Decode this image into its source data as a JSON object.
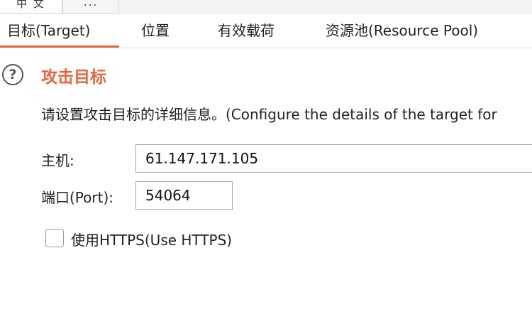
{
  "top_tabs": [
    {
      "label": "中 文"
    },
    {
      "label": "..."
    }
  ],
  "sub_tabs": [
    {
      "label": "目标(Target)",
      "active": true
    },
    {
      "label": "位置"
    },
    {
      "label": "有效载荷"
    },
    {
      "label": "资源池(Resource Pool)"
    }
  ],
  "section": {
    "help_icon": "question-circle-icon",
    "title": "攻击目标",
    "description": "请设置攻击目标的详细信息。(Configure the details of the target for"
  },
  "form": {
    "host_label": "主机:",
    "host_value": "61.147.171.105",
    "port_label": "端口(Port):",
    "port_value": "54064",
    "https_label": "使用HTTPS(Use HTTPS)",
    "https_checked": false
  },
  "colors": {
    "accent": "#e8643a",
    "border": "#a8a8a8"
  }
}
